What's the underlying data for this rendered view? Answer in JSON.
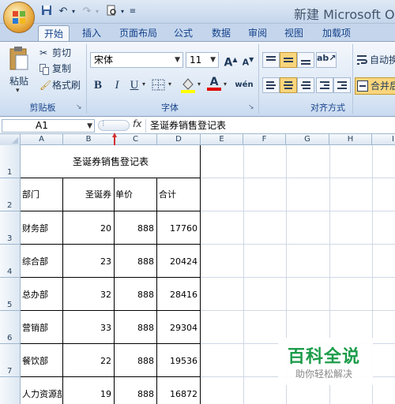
{
  "window": {
    "title": "新建 Microsoft Office Excel 工作表 - Microsoft Excel"
  },
  "ribbon": {
    "tabs": [
      "开始",
      "插入",
      "页面布局",
      "公式",
      "数据",
      "审阅",
      "视图",
      "加载项"
    ],
    "active_tab": "开始",
    "clipboard": {
      "paste_label": "粘贴",
      "cut_label": "剪切",
      "copy_label": "复制",
      "format_painter_label": "格式刷",
      "group_label": "剪贴板"
    },
    "font": {
      "font_name": "宋体",
      "font_size": "11",
      "group_label": "字体",
      "bold": "B",
      "italic": "I",
      "underline": "U",
      "grow": "A",
      "shrink": "A"
    },
    "alignment": {
      "group_label": "对齐方式",
      "wrap_label": "自动换行",
      "merge_label": "合并后居中"
    }
  },
  "formula_bar": {
    "name_box": "A1",
    "fx": "fx",
    "formula": "圣诞券销售登记表"
  },
  "sheet": {
    "columns": [
      "A",
      "B",
      "C",
      "D",
      "E",
      "F",
      "G",
      "H",
      "I"
    ],
    "rows": [
      "1",
      "2",
      "3",
      "4",
      "5",
      "6",
      "7"
    ],
    "title": "圣诞券销售登记表",
    "headers": [
      "部门",
      "圣诞券",
      "单价",
      "合计"
    ],
    "data": [
      [
        "财务部",
        "20",
        "888",
        "17760"
      ],
      [
        "综合部",
        "23",
        "888",
        "20424"
      ],
      [
        "总办部",
        "32",
        "888",
        "28416"
      ],
      [
        "营销部",
        "33",
        "888",
        "29304"
      ],
      [
        "餐饮部",
        "22",
        "888",
        "19536"
      ],
      [
        "人力资源部",
        "19",
        "888",
        "16872"
      ]
    ]
  },
  "watermark": {
    "title": "百科全说",
    "subtitle": "助你轻松解决"
  },
  "colors": {
    "ribbon_text": "#15428b",
    "watermark_green": "#1c9c4a",
    "grid_line": "#d0d7e5"
  }
}
